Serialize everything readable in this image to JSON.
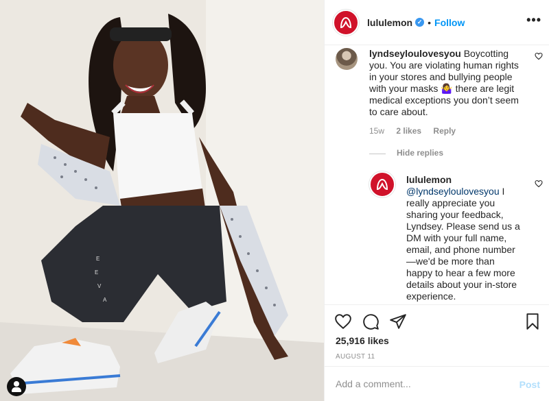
{
  "post": {
    "author": "lululemon",
    "follow_label": "Follow",
    "separator": "•",
    "more_label": "•••",
    "likes": "25,916 likes",
    "date": "AUGUST 11"
  },
  "comment": {
    "username": "lyndseyloulovesyou",
    "text": " Boycotting you. You are violating human rights in your stores and bullying people with your masks 🤷‍♀️ there are legit medical exceptions you don’t seem to care about.",
    "age": "15w",
    "likes": "2 likes",
    "reply_label": "Reply",
    "hide_replies": "Hide replies"
  },
  "reply": {
    "username": "lululemon",
    "mention": "@lyndseyloulovesyou",
    "text": " I really appreciate you sharing your feedback, Lyndsey. Please send us a DM with your full name, email, and phone number—we'd be more than happy to hear a few more details about your in-store experience."
  },
  "composer": {
    "placeholder": "Add a comment...",
    "post_label": "Post"
  },
  "icons": {
    "verified": "verified-badge-icon",
    "like": "heart-icon",
    "comment": "comment-icon",
    "share": "paper-plane-icon",
    "save": "bookmark-icon",
    "user_tags": "user-tag-icon"
  },
  "colors": {
    "brand": "#d0122a",
    "link": "#0095f6",
    "post_disabled": "#b2dffc",
    "muted": "#8e8e8e"
  }
}
